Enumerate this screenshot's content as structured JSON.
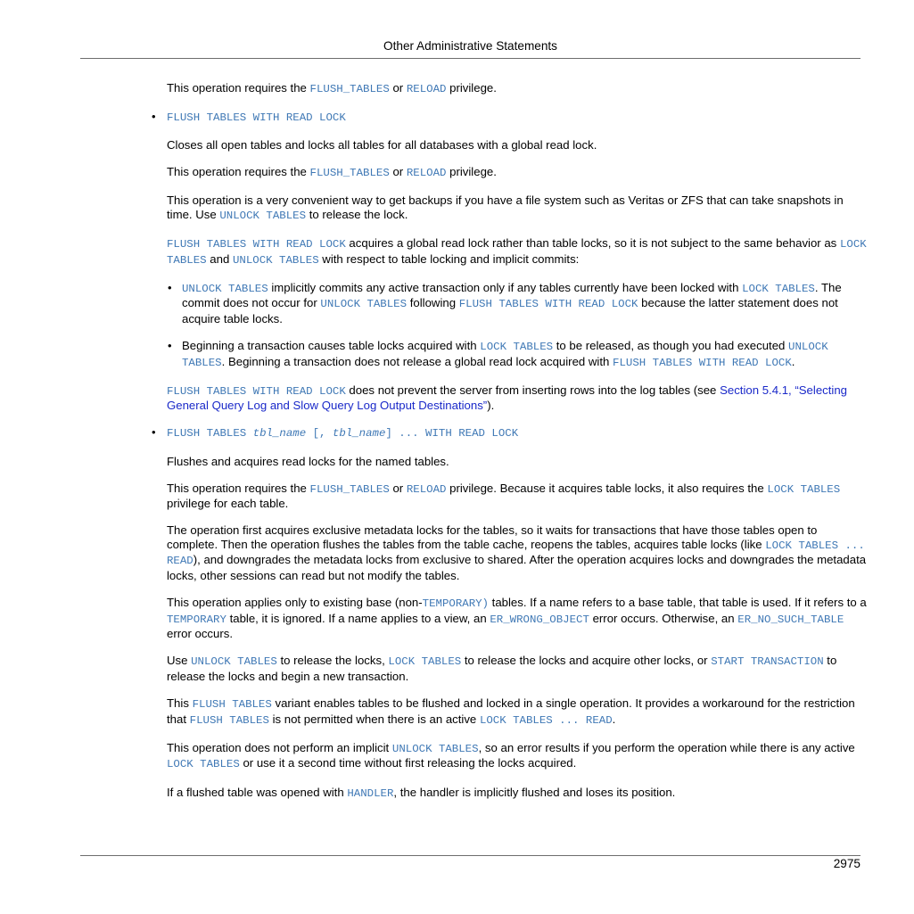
{
  "header": {
    "title": "Other Administrative Statements"
  },
  "footer": {
    "page_number": "2975"
  },
  "p1": {
    "a": "This operation requires the ",
    "b": "FLUSH_TABLES",
    "c": " or ",
    "d": "RELOAD",
    "e": " privilege."
  },
  "item1": {
    "bullet": "•",
    "heading": "FLUSH TABLES WITH READ LOCK",
    "p1": "Closes all open tables and locks all tables for all databases with a global read lock.",
    "p2": {
      "a": "This operation requires the ",
      "b": "FLUSH_TABLES",
      "c": " or ",
      "d": "RELOAD",
      "e": " privilege."
    },
    "p3": {
      "a": "This operation is a very convenient way to get backups if you have a file system such as Veritas or ZFS that can take snapshots in time. Use ",
      "b": "UNLOCK TABLES",
      "c": " to release the lock."
    },
    "p4": {
      "a": "FLUSH TABLES WITH READ LOCK",
      "b": " acquires a global read lock rather than table locks, so it is not subject to the same behavior as ",
      "c": "LOCK TABLES",
      "d": " and ",
      "e": "UNLOCK TABLES",
      "f": " with respect to table locking and implicit commits:"
    },
    "sub1": {
      "bullet": "•",
      "a": "UNLOCK TABLES",
      "b": " implicitly commits any active transaction only if any tables currently have been locked with ",
      "c": "LOCK TABLES",
      "d": ". The commit does not occur for ",
      "e": "UNLOCK TABLES",
      "f": " following ",
      "g": "FLUSH TABLES WITH READ LOCK",
      "h": " because the latter statement does not acquire table locks."
    },
    "sub2": {
      "bullet": "•",
      "a": "Beginning a transaction causes table locks acquired with ",
      "b": "LOCK TABLES",
      "c": " to be released, as though you had executed ",
      "d": "UNLOCK TABLES",
      "e": ". Beginning a transaction does not release a global read lock acquired with ",
      "f": "FLUSH TABLES WITH READ LOCK",
      "g": "."
    },
    "p5": {
      "a": "FLUSH TABLES WITH READ LOCK",
      "b": " does not prevent the server from inserting rows into the log tables (see ",
      "c": "Section 5.4.1, “Selecting General Query Log and Slow Query Log Output Destinations”",
      "d": ")."
    }
  },
  "item2": {
    "bullet": "•",
    "heading": {
      "a": "FLUSH TABLES ",
      "b": "tbl_name",
      "c": " [, ",
      "d": "tbl_name",
      "e": "] ... WITH READ LOCK"
    },
    "p1": "Flushes and acquires read locks for the named tables.",
    "p2": {
      "a": "This operation requires the ",
      "b": "FLUSH_TABLES",
      "c": " or ",
      "d": "RELOAD",
      "e": " privilege. Because it acquires table locks, it also requires the ",
      "f": "LOCK TABLES",
      "g": " privilege for each table."
    },
    "p3": {
      "a": "The operation first acquires exclusive metadata locks for the tables, so it waits for transactions that have those tables open to complete. Then the operation flushes the tables from the table cache, reopens the tables, acquires table locks (like ",
      "b": "LOCK TABLES ... READ",
      "c": "), and downgrades the metadata locks from exclusive to shared. After the operation acquires locks and downgrades the metadata locks, other sessions can read but not modify the tables."
    },
    "p4": {
      "a": "This operation applies only to existing base (non-",
      "b": "TEMPORARY)",
      "c": "  tables. If a name refers to a base table, that table is used. If it refers to a ",
      "d": "TEMPORARY",
      "e": " table, it is ignored. If a name applies to a view, an ",
      "f": "ER_WRONG_OBJECT",
      "g": " error occurs. Otherwise, an ",
      "h": "ER_NO_SUCH_TABLE",
      "i": " error occurs."
    },
    "p5": {
      "a": "Use ",
      "b": "UNLOCK TABLES",
      "c": " to release the locks, ",
      "d": "LOCK TABLES",
      "e": " to release the locks and acquire other locks, or ",
      "f": "START TRANSACTION",
      "g": " to release the locks and begin a new transaction."
    },
    "p6": {
      "a": "This ",
      "b": "FLUSH TABLES",
      "c": " variant enables tables to be flushed and locked in a single operation. It provides a workaround for the restriction that ",
      "d": "FLUSH TABLES",
      "e": " is not permitted when there is an active ",
      "f": "LOCK TABLES ... READ",
      "g": "."
    },
    "p7": {
      "a": "This operation does not perform an implicit ",
      "b": "UNLOCK TABLES",
      "c": ", so an error results if you perform the operation while there is any active ",
      "d": "LOCK TABLES",
      "e": " or use it a second time without first releasing the locks acquired."
    },
    "p8": {
      "a": "If a flushed table was opened with ",
      "b": "HANDLER",
      "c": ", the handler is implicitly flushed and loses its position."
    }
  }
}
